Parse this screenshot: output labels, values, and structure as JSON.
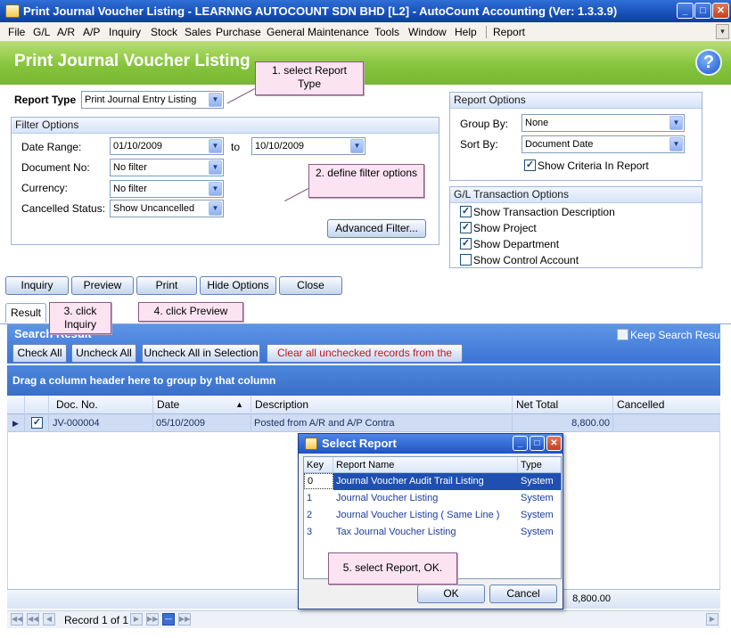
{
  "window": {
    "title": "Print Journal Voucher Listing - LEARNNG AUTOCOUNT SDN BHD [L2] - AutoCount Accounting (Ver: 1.3.3.9)",
    "minimize": "_",
    "maximize": "□",
    "close": "✕"
  },
  "menu": {
    "items": [
      "File",
      "G/L",
      "A/R",
      "A/P",
      "Inquiry",
      "Stock",
      "Sales",
      "Purchase",
      "General Maintenance",
      "Tools",
      "Window",
      "Help",
      "Report"
    ],
    "overflow": "▾"
  },
  "header": {
    "title": "Print Journal Voucher Listing",
    "help": "?"
  },
  "report_type": {
    "label": "Report Type",
    "value": "Print Journal Entry Listing"
  },
  "filter_options": {
    "title": "Filter Options",
    "date_range_label": "Date Range:",
    "date_from": "01/10/2009",
    "to_label": "to",
    "date_to": "10/10/2009",
    "document_no_label": "Document No:",
    "document_no": "No filter",
    "currency_label": "Currency:",
    "currency": "No filter",
    "cancelled_status_label": "Cancelled Status:",
    "cancelled_status": "Show Uncancelled",
    "advanced_filter": "Advanced Filter..."
  },
  "report_options": {
    "title": "Report Options",
    "group_by_label": "Group By:",
    "group_by": "None",
    "sort_by_label": "Sort By:",
    "sort_by": "Document Date",
    "show_criteria": "Show Criteria In Report",
    "show_criteria_checked": true
  },
  "gl_options": {
    "title": "G/L Transaction Options",
    "items": [
      {
        "label": "Show Transaction Description",
        "checked": true
      },
      {
        "label": "Show Project",
        "checked": true
      },
      {
        "label": "Show Department",
        "checked": true
      },
      {
        "label": "Show Control Account",
        "checked": false
      }
    ]
  },
  "actions": {
    "inquiry": "Inquiry",
    "preview": "Preview",
    "print": "Print",
    "hide_options": "Hide Options",
    "close": "Close"
  },
  "callouts": {
    "c1": "1. select Report Type",
    "c2": "2. define filter options",
    "c3": "3. click Inquiry",
    "c4": "4. click Preview",
    "c5": "5. select Report, OK."
  },
  "result_tab": "Result",
  "search_result": {
    "title": "Search Result",
    "keep_label": "Keep Search Result",
    "check_all": "Check All",
    "uncheck_all": "Uncheck All",
    "uncheck_selection": "Uncheck All in Selection",
    "clear_unchecked": "Clear all unchecked records from the grid"
  },
  "grid": {
    "group_hint": "Drag a column header here to group by that column",
    "columns": [
      "Doc. No.",
      "Date",
      "Description",
      "Net Total",
      "Cancelled"
    ],
    "sort_indicator": "▲",
    "rows": [
      {
        "doc_no": "JV-000004",
        "date": "05/10/2009",
        "description": "Posted from A/R and A/P Contra",
        "net_total": "8,800.00",
        "cancelled": "",
        "checked": true
      }
    ],
    "footer_total": "8,800.00"
  },
  "navigator": {
    "record_text": "Record 1 of 1"
  },
  "select_report": {
    "title": "Select Report",
    "columns": [
      "Key",
      "Report Name",
      "Type"
    ],
    "rows": [
      {
        "key": "0",
        "name": "Journal Voucher Audit Trail Listing",
        "type": "System"
      },
      {
        "key": "1",
        "name": "Journal Voucher Listing",
        "type": "System"
      },
      {
        "key": "2",
        "name": "Journal Voucher Listing ( Same Line )",
        "type": "System"
      },
      {
        "key": "3",
        "name": "Tax Journal Voucher Listing",
        "type": "System"
      }
    ],
    "ok": "OK",
    "cancel": "Cancel"
  }
}
